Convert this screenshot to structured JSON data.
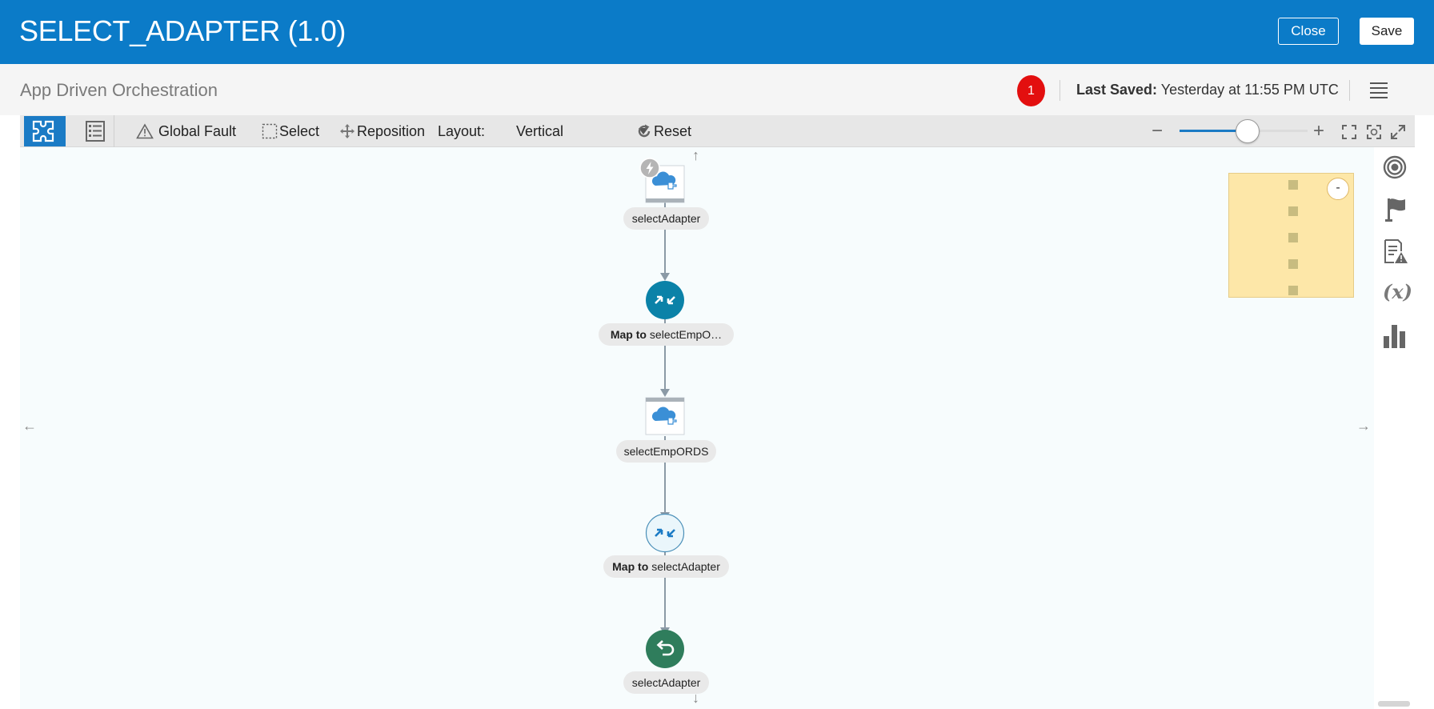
{
  "header": {
    "title": "SELECT_ADAPTER (1.0)",
    "close_label": "Close",
    "save_label": "Save"
  },
  "subheader": {
    "subtitle": "App Driven Orchestration",
    "error_count": "1",
    "last_saved_label": "Last Saved:",
    "last_saved_value": "Yesterday at 11:55 PM UTC"
  },
  "toolbar": {
    "global_fault": "Global Fault",
    "select": "Select",
    "reposition": "Reposition",
    "layout_label": "Layout:",
    "layout_value": "Vertical",
    "reset": "Reset",
    "zoom_level": 0.53
  },
  "flow": {
    "nodes": [
      {
        "kind": "trigger",
        "label": "selectAdapter"
      },
      {
        "kind": "map",
        "bold": "Map to",
        "label": "selectEmpO…"
      },
      {
        "kind": "invoke",
        "label": "selectEmpORDS"
      },
      {
        "kind": "map",
        "bold": "Map to",
        "label": "selectAdapter"
      },
      {
        "kind": "return",
        "label": "selectAdapter"
      }
    ]
  },
  "minimap": {
    "toggle_label": "-"
  },
  "colors": {
    "header_bg": "#0b7bc8",
    "accent": "#1b7bc5",
    "map_node": "#0b82a8",
    "return_node": "#2f7d5c",
    "error_badge": "#e30f0f",
    "minimap_bg": "#fde7a8"
  },
  "icons": {
    "view_canvas": "puzzle-icon",
    "view_list": "list-icon",
    "global_fault": "warning-icon",
    "select": "select-marquee-icon",
    "reposition": "move-icon",
    "reset": "refresh-icon",
    "rail": [
      "target-icon",
      "flag-icon",
      "report-warning-icon",
      "variable-icon",
      "bar-chart-icon"
    ]
  }
}
